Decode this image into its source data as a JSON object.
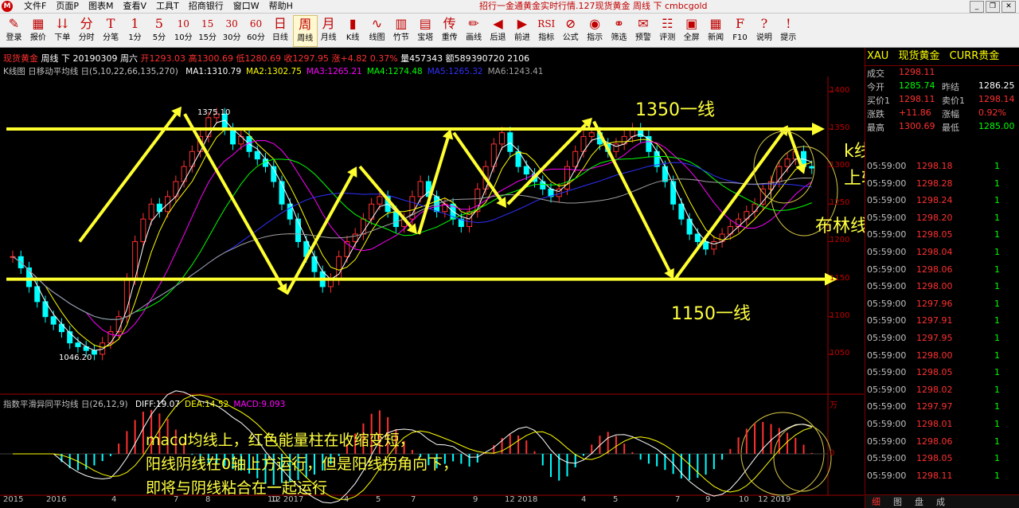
{
  "app": {
    "logo": "M",
    "menu": [
      "文件F",
      "页面P",
      "图表M",
      "查看V",
      "工具T",
      "招商银行",
      "窗口W",
      "帮助H"
    ],
    "window_title": "招行一金通黄金实时行情.127现货黄金 周线 下 cmbcgold",
    "window_buttons": [
      "_",
      "❐",
      "✕"
    ]
  },
  "toolbar": [
    {
      "icon": "✎",
      "label": "登录"
    },
    {
      "icon": "▦",
      "label": "报价"
    },
    {
      "icon": "⇊",
      "label": "下单"
    },
    {
      "icon": "分",
      "label": "分时"
    },
    {
      "icon": "T",
      "label": "分笔"
    },
    {
      "icon": "1",
      "label": "1分"
    },
    {
      "icon": "5",
      "label": "5分"
    },
    {
      "icon": "10",
      "label": "10分"
    },
    {
      "icon": "15",
      "label": "15分"
    },
    {
      "icon": "30",
      "label": "30分"
    },
    {
      "icon": "60",
      "label": "60分"
    },
    {
      "icon": "日",
      "label": "日线"
    },
    {
      "icon": "周",
      "label": "周线"
    },
    {
      "icon": "月",
      "label": "月线"
    },
    {
      "icon": "▮",
      "label": "K线"
    },
    {
      "icon": "∿",
      "label": "线图"
    },
    {
      "icon": "▥",
      "label": "竹节"
    },
    {
      "icon": "▤",
      "label": "宝塔"
    },
    {
      "icon": "传",
      "label": "重传"
    },
    {
      "icon": "✏",
      "label": "画线"
    },
    {
      "icon": "◀",
      "label": "后退"
    },
    {
      "icon": "▶",
      "label": "前进"
    },
    {
      "icon": "RSI",
      "label": "指标"
    },
    {
      "icon": "⊘",
      "label": "公式"
    },
    {
      "icon": "◉",
      "label": "指示"
    },
    {
      "icon": "⚭",
      "label": "筛选"
    },
    {
      "icon": "✉",
      "label": "预警"
    },
    {
      "icon": "☷",
      "label": "评测"
    },
    {
      "icon": "▣",
      "label": "全屏"
    },
    {
      "icon": "▦",
      "label": "新闻"
    },
    {
      "icon": "F",
      "label": "F10"
    },
    {
      "icon": "?",
      "label": "说明"
    },
    {
      "icon": "!",
      "label": "提示"
    }
  ],
  "header": {
    "instrument": "现货黄金",
    "period": "周线 下",
    "date": "20190309 周六",
    "open": "开1293.03",
    "high": "高1300.69",
    "low": "低1280.69",
    "close": "收1297.95",
    "change": "涨+4.82 0.37%",
    "volume": "量457343",
    "amount": "额589390720",
    "extra": "2106"
  },
  "ma_line": {
    "title": "K线图 日移动平均线 日(5,10,22,66,135,270)",
    "items": [
      {
        "label": "MA1:1310.79",
        "color": "#ffffff"
      },
      {
        "label": "MA2:1302.75",
        "color": "#ffff00"
      },
      {
        "label": "MA3:1265.21",
        "color": "#ff00ff"
      },
      {
        "label": "MA4:1274.48",
        "color": "#00ff00"
      },
      {
        "label": "MA5:1265.32",
        "color": "#3030ff"
      },
      {
        "label": "MA6:1243.41",
        "color": "#a0a0a0"
      }
    ]
  },
  "macd_line": {
    "title": "指数平滑异同平均线 日(26,12,9)",
    "items": [
      {
        "label": "DIFF:19.07",
        "color": "#ffffff"
      },
      {
        "label": "DEA:14.52",
        "color": "#ffff00"
      },
      {
        "label": "MACD:9.093",
        "color": "#ff00ff"
      }
    ]
  },
  "chart_data": {
    "type": "candlestick",
    "y_ticks": [
      "1400",
      "1350",
      "1300",
      "1250",
      "1200",
      "1150",
      "1100",
      "1050"
    ],
    "macd_ticks": [
      "万",
      "0"
    ],
    "x_ticks": [
      "2015",
      "2016",
      "4",
      "7",
      "8",
      "10",
      "12 2017",
      "4",
      "5",
      "7",
      "9",
      "12 2018",
      "4",
      "5",
      "7",
      "9",
      "10",
      "12 2019",
      "1"
    ],
    "annotations": {
      "high_label": "1375.10",
      "low_label": "1046.20",
      "line_1350": "1350一线",
      "line_1150": "1150一线",
      "note_kline_1": "k线整体在布林线",
      "note_kline_2": "上轨运行",
      "note_boll": "布林线中仓运行",
      "note_macd_1": "macd均线上，红色能量柱在收缩变短，",
      "note_macd_2": "阳线阴线在0轴上方运行，但是阳线拐角向下，",
      "note_macd_3": "即将与阴线粘合在一起运行"
    },
    "weekly_close": [
      1180,
      1165,
      1140,
      1120,
      1100,
      1090,
      1080,
      1065,
      1060,
      1055,
      1050,
      1065,
      1080,
      1100,
      1150,
      1200,
      1230,
      1250,
      1240,
      1260,
      1280,
      1300,
      1320,
      1340,
      1365,
      1370,
      1350,
      1330,
      1340,
      1320,
      1310,
      1300,
      1280,
      1250,
      1230,
      1200,
      1180,
      1160,
      1140,
      1150,
      1180,
      1200,
      1210,
      1230,
      1250,
      1260,
      1240,
      1220,
      1230,
      1260,
      1280,
      1260,
      1240,
      1250,
      1230,
      1220,
      1240,
      1270,
      1300,
      1330,
      1345,
      1320,
      1300,
      1290,
      1280,
      1270,
      1260,
      1270,
      1300,
      1320,
      1340,
      1345,
      1330,
      1320,
      1330,
      1340,
      1350,
      1340,
      1320,
      1300,
      1280,
      1250,
      1230,
      1210,
      1200,
      1190,
      1200,
      1210,
      1220,
      1230,
      1240,
      1250,
      1270,
      1280,
      1300,
      1310,
      1320,
      1300,
      1298
    ]
  },
  "right_panel": {
    "code": "XAU",
    "name": "现货黄金",
    "curr": "CURR贵金",
    "rows": [
      {
        "k1": "成交",
        "v1": "1298.11",
        "k2": "",
        "v2": "",
        "c1": "#ff3030",
        "c2": ""
      },
      {
        "k1": "今开",
        "v1": "1285.74",
        "k2": "昨结",
        "v2": "1286.25",
        "c1": "#00ff00",
        "c2": "#ffffff"
      },
      {
        "k1": "买价1",
        "v1": "1298.11",
        "k2": "卖价1",
        "v2": "1298.14",
        "c1": "#ff3030",
        "c2": "#ff3030"
      },
      {
        "k1": "涨跌",
        "v1": "+11.86",
        "k2": "涨幅",
        "v2": "0.92%",
        "c1": "#ff3030",
        "c2": "#ff3030"
      },
      {
        "k1": "最高",
        "v1": "1300.69",
        "k2": "最低",
        "v2": "1285.00",
        "c1": "#ff3030",
        "c2": "#00ff00"
      }
    ],
    "ticks": [
      {
        "t": "05:59:00",
        "p": "1298.18",
        "v": "1",
        "c": "#ff3030"
      },
      {
        "t": "05:59:00",
        "p": "1298.28",
        "v": "1",
        "c": "#ff3030"
      },
      {
        "t": "05:59:00",
        "p": "1298.24",
        "v": "1",
        "c": "#ff3030"
      },
      {
        "t": "05:59:00",
        "p": "1298.20",
        "v": "1",
        "c": "#ff3030"
      },
      {
        "t": "05:59:00",
        "p": "1298.05",
        "v": "1",
        "c": "#ff3030"
      },
      {
        "t": "05:59:00",
        "p": "1298.04",
        "v": "1",
        "c": "#ff3030"
      },
      {
        "t": "05:59:00",
        "p": "1298.06",
        "v": "1",
        "c": "#ff3030"
      },
      {
        "t": "05:59:00",
        "p": "1298.00",
        "v": "1",
        "c": "#ff3030"
      },
      {
        "t": "05:59:00",
        "p": "1297.96",
        "v": "1",
        "c": "#ff3030"
      },
      {
        "t": "05:59:00",
        "p": "1297.91",
        "v": "1",
        "c": "#ff3030"
      },
      {
        "t": "05:59:00",
        "p": "1297.95",
        "v": "1",
        "c": "#ff3030"
      },
      {
        "t": "05:59:00",
        "p": "1298.00",
        "v": "1",
        "c": "#ff3030"
      },
      {
        "t": "05:59:00",
        "p": "1298.05",
        "v": "1",
        "c": "#ff3030"
      },
      {
        "t": "05:59:00",
        "p": "1298.02",
        "v": "1",
        "c": "#ff3030"
      },
      {
        "t": "05:59:00",
        "p": "1297.97",
        "v": "1",
        "c": "#ff3030"
      },
      {
        "t": "05:59:00",
        "p": "1298.01",
        "v": "1",
        "c": "#ff3030"
      },
      {
        "t": "05:59:00",
        "p": "1298.06",
        "v": "1",
        "c": "#ff3030"
      },
      {
        "t": "05:59:00",
        "p": "1298.05",
        "v": "1",
        "c": "#ff3030"
      },
      {
        "t": "05:59:00",
        "p": "1298.11",
        "v": "1",
        "c": "#ff3030"
      }
    ],
    "footer": [
      "细",
      "图",
      "盘",
      "成"
    ]
  },
  "colors": {
    "up": "#ff3030",
    "down": "#00ffff",
    "accent": "#ffff00",
    "axis": "#c00000"
  }
}
